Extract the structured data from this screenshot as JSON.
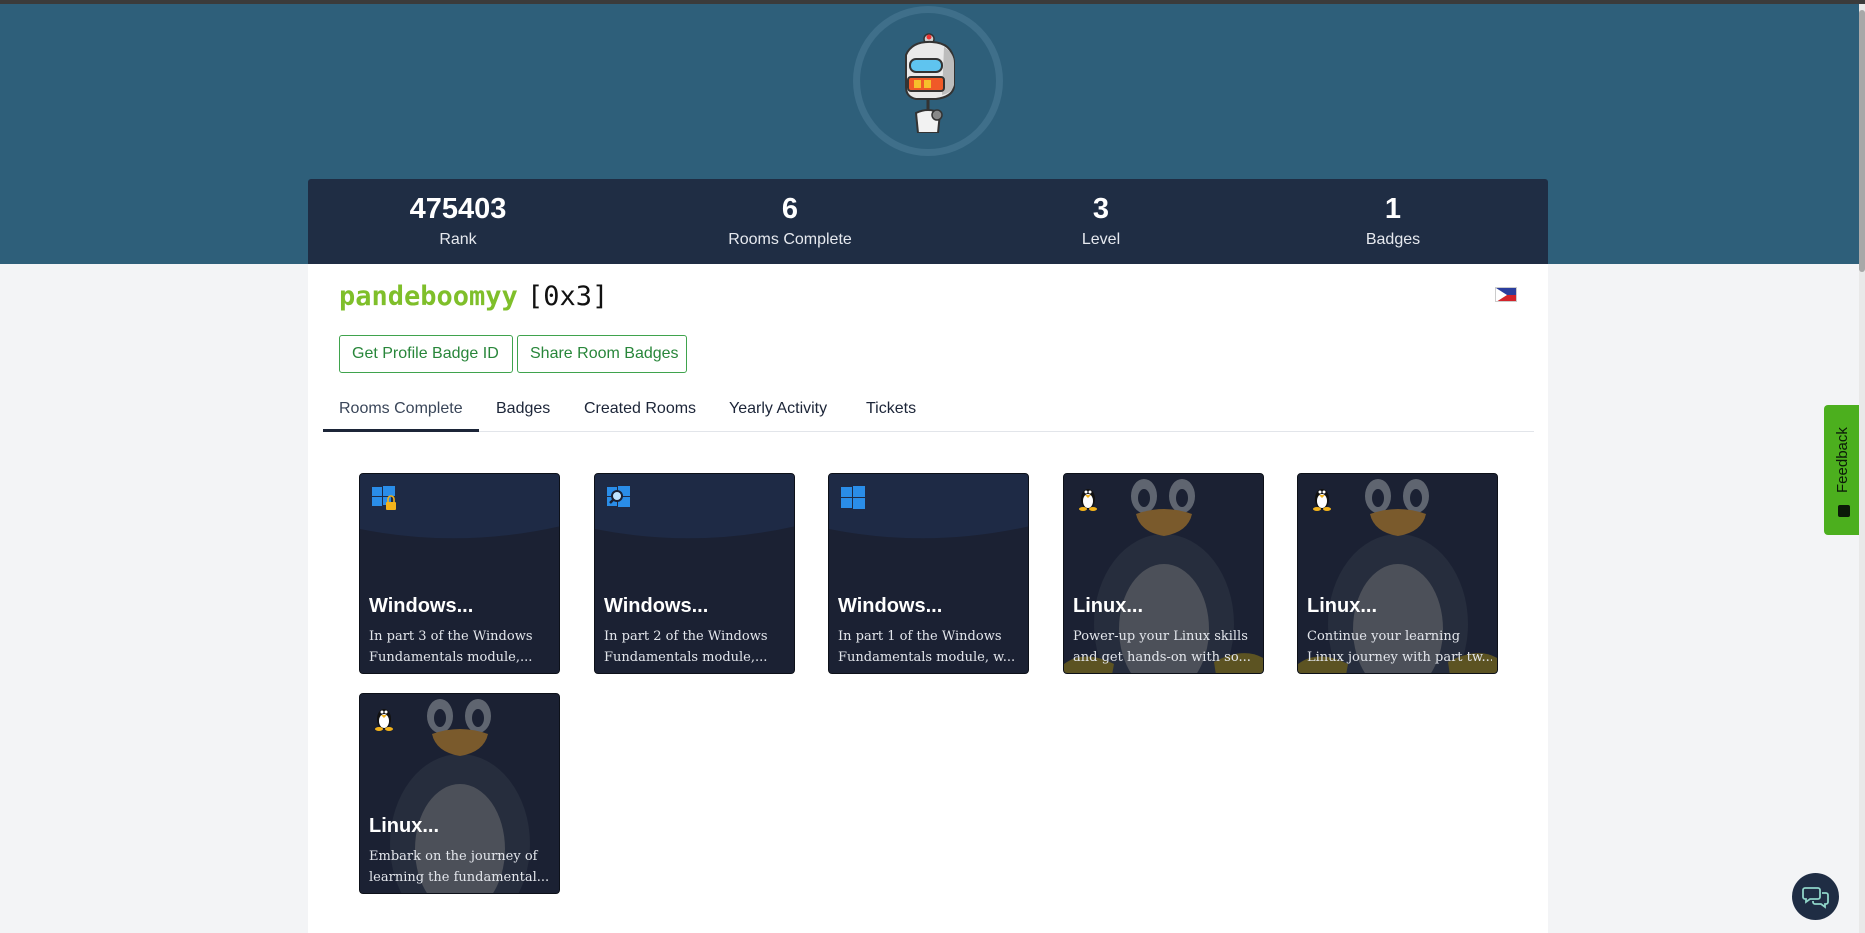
{
  "profile": {
    "username": "pandeboomyy",
    "rank_tag": "[0x3]",
    "flag": "philippines-flag-icon"
  },
  "stats": [
    {
      "value": "475403",
      "label": "Rank"
    },
    {
      "value": "6",
      "label": "Rooms Complete"
    },
    {
      "value": "3",
      "label": "Level"
    },
    {
      "value": "1",
      "label": "Badges"
    }
  ],
  "actions": {
    "badge_id_label": "Get Profile Badge ID",
    "share_label": "Share Room Badges"
  },
  "tabs": [
    {
      "label": "Rooms Complete",
      "active": true
    },
    {
      "label": "Badges"
    },
    {
      "label": "Created Rooms"
    },
    {
      "label": "Yearly Activity"
    },
    {
      "label": "Tickets"
    }
  ],
  "rooms": [
    {
      "title": "Windows...",
      "desc1": "In part 3 of the Windows",
      "desc2": "Fundamentals module,...",
      "icon": "windows-lock-icon"
    },
    {
      "title": "Windows...",
      "desc1": "In part 2 of the Windows",
      "desc2": "Fundamentals module,...",
      "icon": "windows-search-icon"
    },
    {
      "title": "Windows...",
      "desc1": "In part 1 of the Windows",
      "desc2": "Fundamentals module, w...",
      "icon": "windows-icon"
    },
    {
      "title": "Linux...",
      "desc1": "Power-up your Linux skills",
      "desc2": "and get hands-on with so...",
      "icon": "linux-penguin-icon"
    },
    {
      "title": "Linux...",
      "desc1": "Continue your learning",
      "desc2": "Linux journey with part tw...",
      "icon": "linux-penguin-icon"
    },
    {
      "title": "Linux...",
      "desc1": "Embark on the journey of",
      "desc2": "learning the fundamental...",
      "icon": "linux-penguin-icon"
    }
  ],
  "feedback": {
    "label": "Feedback"
  },
  "colors": {
    "hero": "#2e5f7a",
    "stats_bar": "#1f2d44",
    "username": "#7fbf2a",
    "button": "#3fa34d",
    "feedback": "#4caf1e"
  }
}
